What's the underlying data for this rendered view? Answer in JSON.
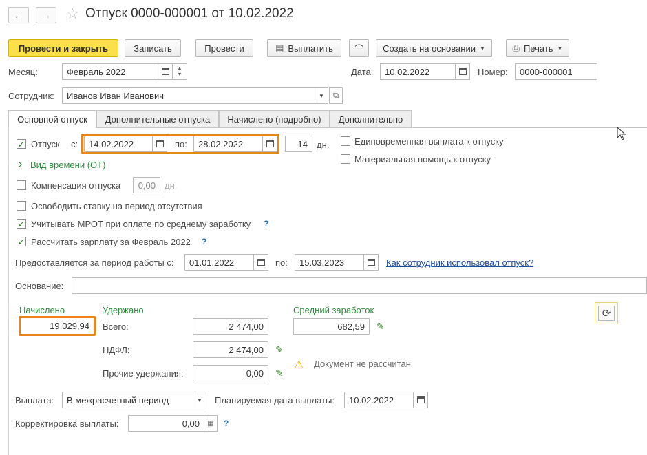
{
  "window": {
    "title": "Отпуск 0000-000001 от 10.02.2022",
    "back_icon": "←",
    "forward_icon": "→",
    "star_icon": "☆"
  },
  "toolbar": {
    "post_close": "Провести и закрыть",
    "save": "Записать",
    "post": "Провести",
    "pay": "Выплатить",
    "attach_icon": "📎",
    "create_based": "Создать на основании",
    "print": "Печать"
  },
  "header": {
    "month_label": "Месяц:",
    "month_value": "Февраль 2022",
    "date_label": "Дата:",
    "date_value": "10.02.2022",
    "number_label": "Номер:",
    "number_value": "0000-000001",
    "employee_label": "Сотрудник:",
    "employee_value": "Иванов Иван Иванович"
  },
  "tabs": [
    {
      "label": "Основной отпуск"
    },
    {
      "label": "Дополнительные отпуска"
    },
    {
      "label": "Начислено (подробно)"
    },
    {
      "label": "Дополнительно"
    }
  ],
  "main": {
    "vacation_label": "Отпуск",
    "vacation_checked": true,
    "from_label": "с:",
    "from_value": "14.02.2022",
    "to_label": "по:",
    "to_value": "28.02.2022",
    "days_value": "14",
    "days_unit": "дн.",
    "time_type_link": "Вид времени (ОТ)",
    "lump_sum_label": "Единовременная выплата к отпуску",
    "material_aid_label": "Материальная помощь к отпуску",
    "compensation_label": "Компенсация отпуска",
    "compensation_value": "0,00",
    "compensation_unit": "дн.",
    "release_rate_label": "Освободить ставку на период отсутствия",
    "mrot_label": "Учитывать МРОТ при оплате по среднему заработку",
    "calc_salary_label": "Рассчитать зарплату за Февраль 2022",
    "period_label": "Предоставляется за период работы с:",
    "period_from": "01.01.2022",
    "period_to_label": "по:",
    "period_to": "15.03.2023",
    "usage_link": "Как сотрудник использовал отпуск?",
    "basis_label": "Основание:",
    "basis_value": "",
    "accrued_title": "Начислено",
    "accrued_value": "19 029,94",
    "withheld_title": "Удержано",
    "total_label": "Всего:",
    "total_value": "2 474,00",
    "ndfl_label": "НДФЛ:",
    "ndfl_value": "2 474,00",
    "other_label": "Прочие удержания:",
    "other_value": "0,00",
    "avg_title": "Средний заработок",
    "avg_value": "682,59",
    "warning_text": "Документ не рассчитан",
    "payment_label": "Выплата:",
    "payment_value": "В межрасчетный период",
    "planned_date_label": "Планируемая дата выплаты:",
    "planned_date_value": "10.02.2022",
    "correction_label": "Корректировка выплаты:",
    "correction_value": "0,00",
    "question_mark": "?",
    "refresh_icon": "⟳",
    "warning_icon": "⚠",
    "pencil_icon": "✎",
    "check_mark": "✓",
    "chevron_icon": "›",
    "caret_icon": "▼",
    "accent_orange": "#e8861a",
    "accent_green": "#2e8b3e"
  }
}
